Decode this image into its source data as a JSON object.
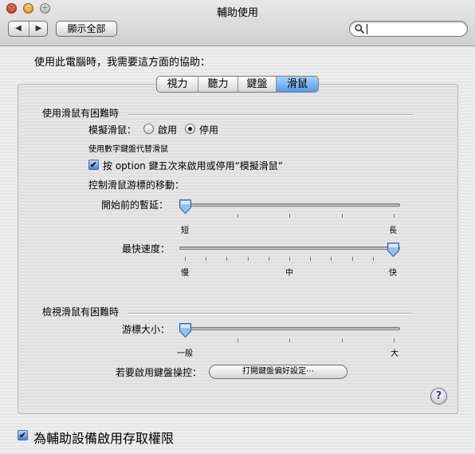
{
  "window": {
    "title": "輔助使用",
    "close_glyph": "×",
    "minimize_glyph": "–",
    "zoom_glyph": "+"
  },
  "toolbar": {
    "back_glyph": "◀",
    "forward_glyph": "▶",
    "show_all_label": "顯示全部",
    "search": {
      "value": "",
      "placeholder": ""
    }
  },
  "prompt": "使用此電腦時，我需要這方面的協助：",
  "tabs": [
    {
      "label": "視力",
      "selected": false
    },
    {
      "label": "聽力",
      "selected": false
    },
    {
      "label": "鍵盤",
      "selected": false
    },
    {
      "label": "滑鼠",
      "selected": true
    }
  ],
  "mouse_difficulty": {
    "title": "使用滑鼠有困難時",
    "mouse_keys_label": "模擬滑鼠：",
    "option_on": "啟用",
    "option_off": "停用",
    "selected": "停用",
    "hint": "使用數字鍵盤代替滑鼠",
    "option_toggle_label": "按 option 鍵五次來啟用或停用“模擬滑鼠”",
    "option_toggle_checked": true,
    "control_label": "控制滑鼠游標的移動：",
    "initial_delay": {
      "label": "開始前的暫延：",
      "min_label": "短",
      "max_label": "長",
      "value_fraction": 0.0
    },
    "max_speed": {
      "label": "最快速度：",
      "min_label": "慢",
      "mid_label": "中",
      "max_label": "快",
      "value_fraction": 1.0
    }
  },
  "seeing_difficulty": {
    "title": "檢視滑鼠有困難時",
    "cursor_size": {
      "label": "游標大小：",
      "min_label": "一般",
      "max_label": "大",
      "value_fraction": 0.0
    },
    "keyboard_access_label": "若要啟用鍵盤操控：",
    "open_keyboard_button": "打開鍵盤偏好設定⋯"
  },
  "help_glyph": "?",
  "check_glyph": "✔",
  "bottom": {
    "label": "為輔助設備啟用存取權限",
    "checked": true
  },
  "colors": {
    "accent": "#3b87e0",
    "selected_tab": "#4f9ae8"
  }
}
